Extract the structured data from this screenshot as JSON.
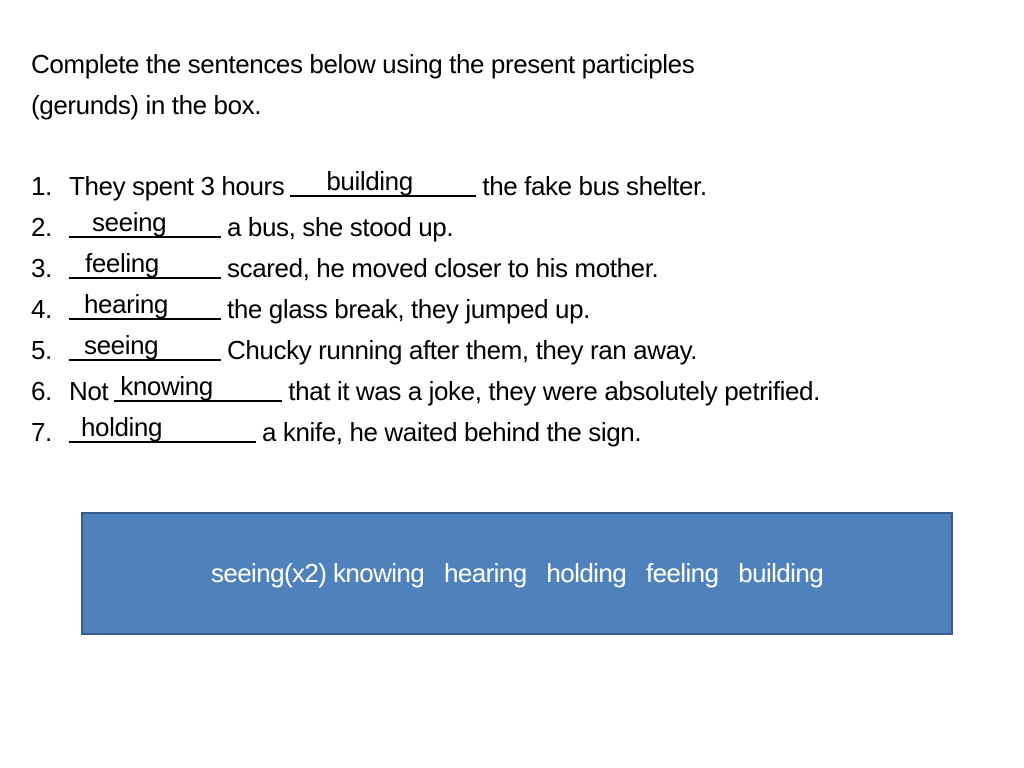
{
  "instructions": {
    "line1": "Complete the sentences below using the present participles",
    "line2": "(gerunds) in the box."
  },
  "exercises": [
    {
      "number": "1.",
      "before": "They spent 3 hours",
      "answer": "building",
      "after": "the fake bus shelter."
    },
    {
      "number": "2.",
      "before": "",
      "answer": "seeing",
      "after": "a bus, she stood up."
    },
    {
      "number": "3.",
      "before": "",
      "answer": "feeling",
      "after": "scared, he moved closer to his mother."
    },
    {
      "number": "4.",
      "before": "",
      "answer": "hearing",
      "after": "the glass break, they jumped up."
    },
    {
      "number": "5.",
      "before": "",
      "answer": "seeing",
      "after": "Chucky running after them, they ran away."
    },
    {
      "number": "6.",
      "before": "Not",
      "answer": "knowing",
      "after": "that it was a joke, they were absolutely petrified."
    },
    {
      "number": "7.",
      "before": "",
      "answer": "holding",
      "after": "a knife, he waited behind the sign."
    }
  ],
  "word_bank": {
    "text": "seeing(x2) knowing   hearing   holding   feeling   building",
    "fill_color": "#4F81BD",
    "border_color": "#385D8A",
    "text_color": "#FFFFFF"
  }
}
